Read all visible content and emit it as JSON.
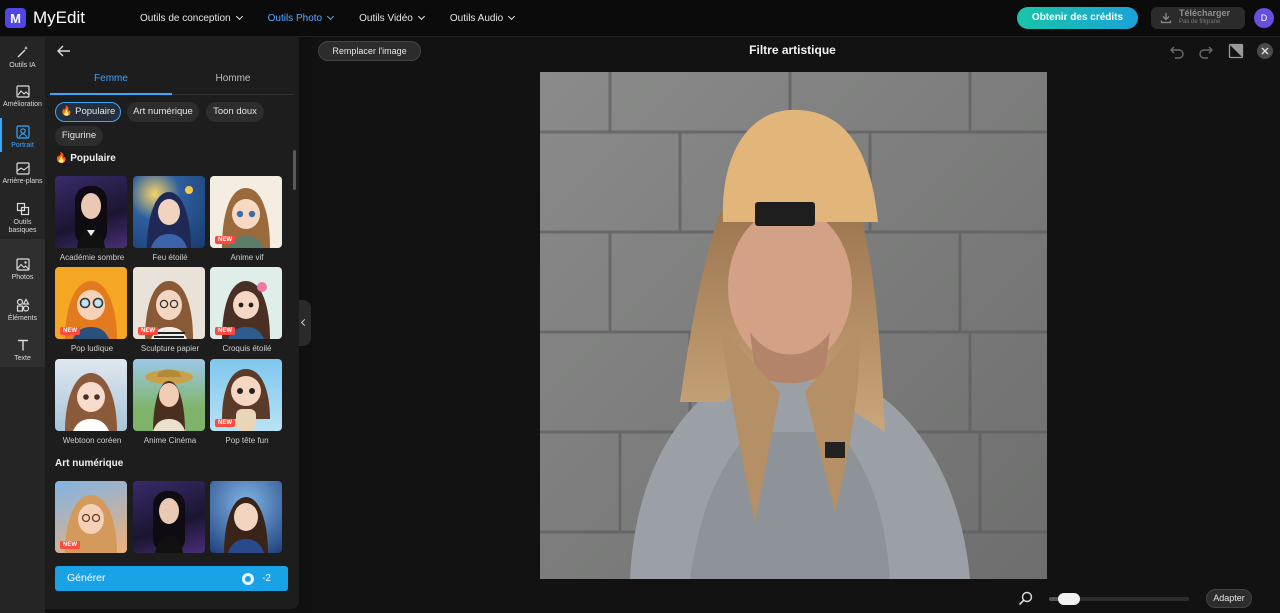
{
  "app": {
    "name": "MyEdit",
    "logo_letter": "M"
  },
  "nav": {
    "items": [
      {
        "label": "Outils de conception",
        "active": false
      },
      {
        "label": "Outils Photo",
        "active": true
      },
      {
        "label": "Outils Vidéo",
        "active": false
      },
      {
        "label": "Outils Audio",
        "active": false
      }
    ]
  },
  "header": {
    "credits_label": "Obtenir des crédits",
    "download_label": "Télécharger",
    "download_sub": "Pas de filigrane",
    "avatar_letter": "D"
  },
  "rail": {
    "items": [
      {
        "label": "Outils IA",
        "icon": "magic-wand-icon"
      },
      {
        "label": "Amélioration",
        "icon": "enhance-image-icon"
      },
      {
        "label": "Portrait",
        "icon": "portrait-icon",
        "active": true
      },
      {
        "label": "Arrière-plans",
        "icon": "background-icon"
      },
      {
        "label": "Outils basiques",
        "icon": "crop-icon"
      },
      {
        "label": "Photos",
        "icon": "photo-icon"
      },
      {
        "label": "Éléments",
        "icon": "shapes-icon"
      },
      {
        "label": "Texte",
        "icon": "text-icon"
      }
    ]
  },
  "panel": {
    "tabs": [
      {
        "label": "Femme",
        "active": true
      },
      {
        "label": "Homme",
        "active": false
      }
    ],
    "chips": [
      {
        "label": "🔥 Populaire",
        "active": true
      },
      {
        "label": "Art numérique",
        "active": false
      },
      {
        "label": "Toon doux",
        "active": false
      },
      {
        "label": "Figurine",
        "active": false
      }
    ],
    "section_popular": "🔥 Populaire",
    "section_digital": "Art numérique",
    "styles": [
      {
        "label": "Académie sombre",
        "new": false
      },
      {
        "label": "Feu étoilé",
        "new": false
      },
      {
        "label": "Anime vif",
        "new": true
      },
      {
        "label": "Pop ludique",
        "new": true
      },
      {
        "label": "Sculpture papier",
        "new": true
      },
      {
        "label": "Croquis étoilé",
        "new": true
      },
      {
        "label": "Webtoon coréen",
        "new": false
      },
      {
        "label": "Anime Cinéma",
        "new": false
      },
      {
        "label": "Pop tête fun",
        "new": true
      }
    ],
    "digital_styles": [
      {
        "new": true
      },
      {
        "new": false
      },
      {
        "new": false
      }
    ],
    "new_badge": "NEW",
    "generate_label": "Générer",
    "generate_cost": "-2"
  },
  "canvas": {
    "replace_label": "Remplacer l'image",
    "title": "Filtre artistique",
    "fit_label": "Adapter",
    "zoom_fraction": 0.08
  },
  "colors": {
    "accent": "#3aa6ff",
    "credits": "#19c4a6",
    "generate": "#19a3e6",
    "new_badge": "#ff4a3d"
  }
}
